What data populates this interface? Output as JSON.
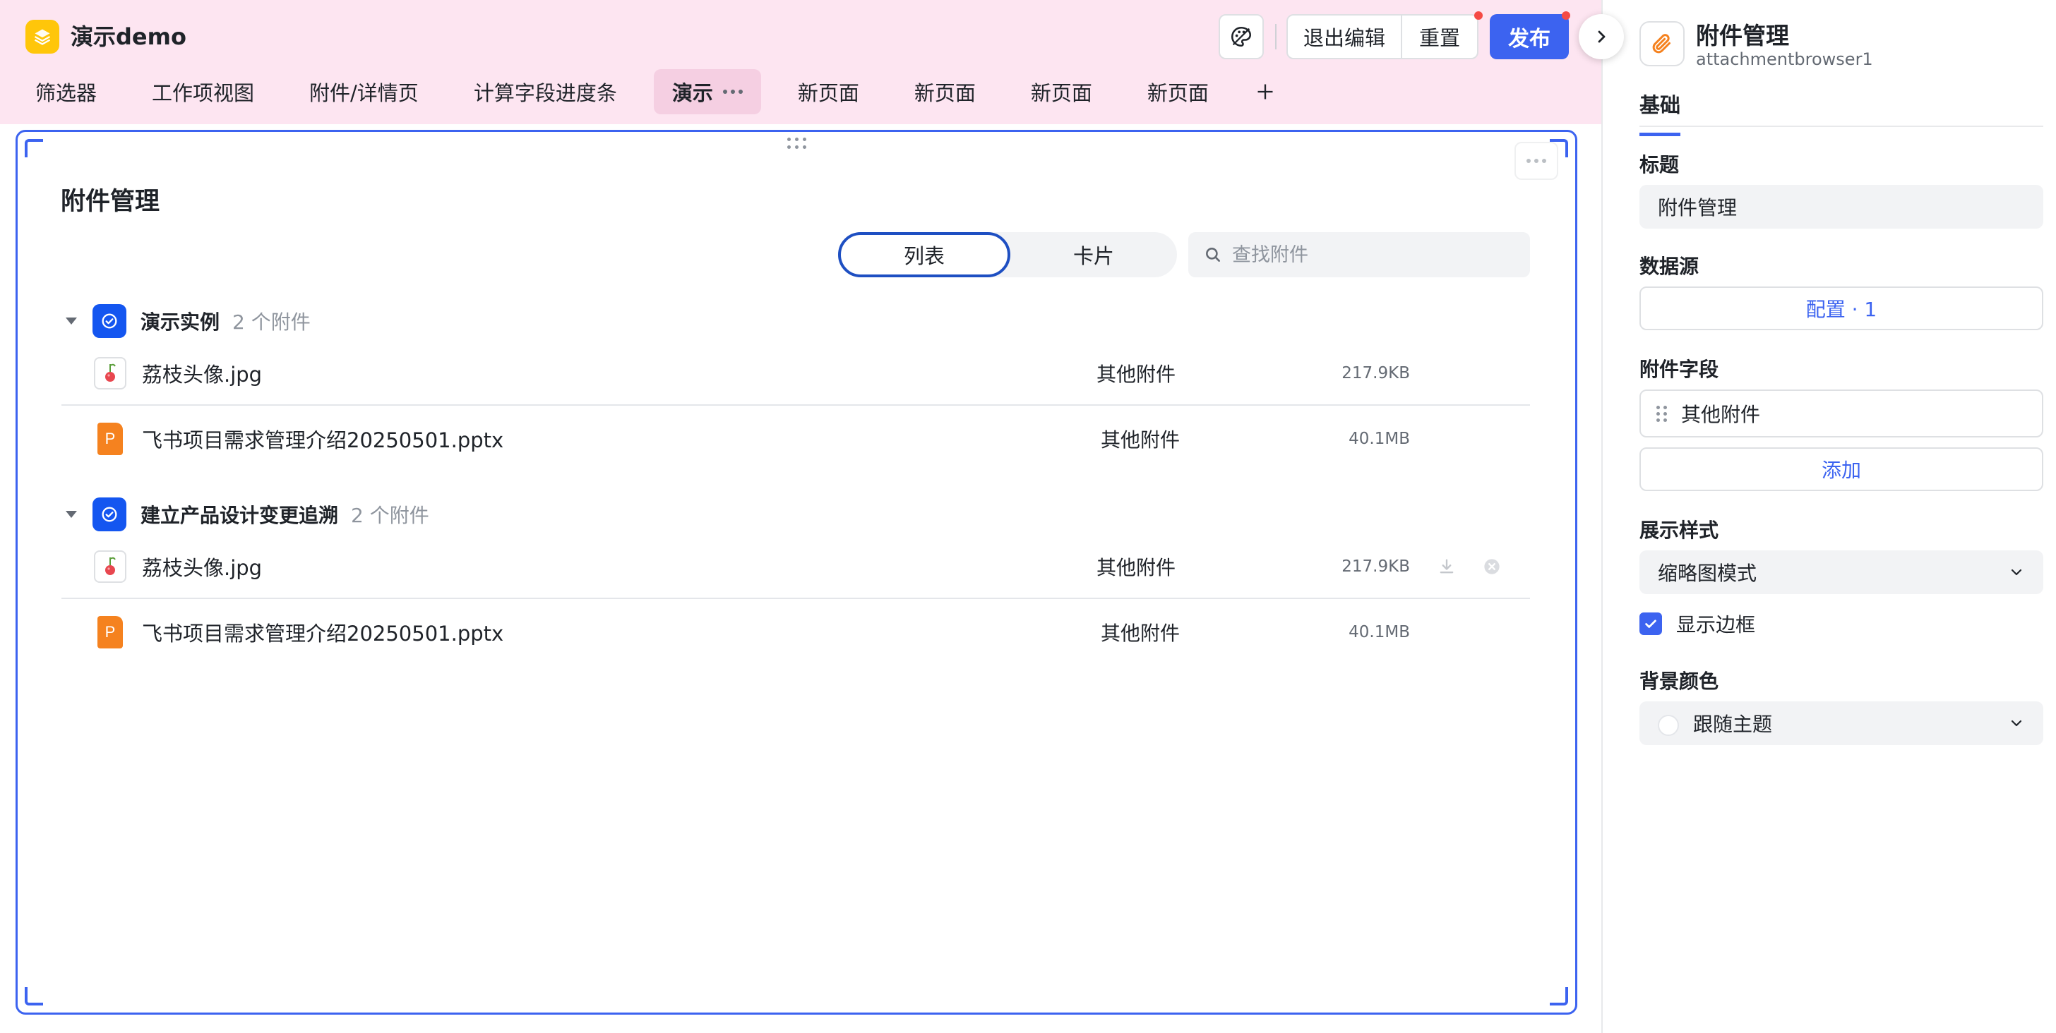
{
  "app": {
    "title": "演示demo"
  },
  "toolbar": {
    "exit_edit": "退出编辑",
    "reset": "重置",
    "publish": "发布"
  },
  "tabs": [
    {
      "label": "筛选器"
    },
    {
      "label": "工作项视图"
    },
    {
      "label": "附件/详情页"
    },
    {
      "label": "计算字段进度条"
    },
    {
      "label": "演示",
      "active": true
    },
    {
      "label": "新页面"
    },
    {
      "label": "新页面"
    },
    {
      "label": "新页面"
    },
    {
      "label": "新页面"
    }
  ],
  "block": {
    "title": "附件管理",
    "view_options": [
      "列表",
      "卡片"
    ],
    "active_view": "列表",
    "search": {
      "placeholder": "查找附件",
      "value": ""
    },
    "groups": [
      {
        "name": "演示实例",
        "count": "2 个附件",
        "files": [
          {
            "name": "荔枝头像.jpg",
            "type": "image",
            "field": "其他附件",
            "size": "217.9KB"
          },
          {
            "name": "飞书项目需求管理介绍20250501.pptx",
            "type": "pptx",
            "field": "其他附件",
            "size": "40.1MB"
          }
        ]
      },
      {
        "name": "建立产品设计变更追溯",
        "count": "2 个附件",
        "files": [
          {
            "name": "荔枝头像.jpg",
            "type": "image",
            "field": "其他附件",
            "size": "217.9KB"
          },
          {
            "name": "飞书项目需求管理介绍20250501.pptx",
            "type": "pptx",
            "field": "其他附件",
            "size": "40.1MB"
          }
        ]
      }
    ],
    "ppt_letter": "P"
  },
  "panel": {
    "title": "附件管理",
    "subtitle": "attachmentbrowser1",
    "tab": "基础",
    "title_label": "标题",
    "title_value": "附件管理",
    "datasource_label": "数据源",
    "datasource_button": "配置 · 1",
    "field_label": "附件字段",
    "field_item": "其他附件",
    "add_button": "添加",
    "style_label": "展示样式",
    "style_value": "缩略图模式",
    "border_label": "显示边框",
    "border_checked": true,
    "bg_label": "背景颜色",
    "bg_value": "跟随主题"
  },
  "colors": {
    "accent": "#3c63f0",
    "header_bg": "#fde5f1",
    "logo": "#ffc60a",
    "ppt": "#f5821f",
    "badge_dot": "#f54a45"
  }
}
